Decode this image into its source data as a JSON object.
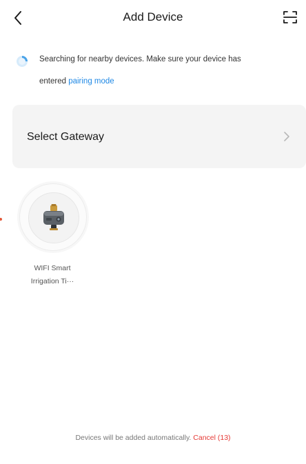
{
  "header": {
    "back_icon": "chevron-left-icon",
    "title": "Add Device",
    "scan_icon": "scan-frame-icon"
  },
  "search": {
    "spinner_icon": "loading-spinner-icon",
    "message_line1": "Searching for nearby devices. Make sure your device has",
    "message_line2_prefix": "entered ",
    "pairing_link": "pairing mode"
  },
  "gateway": {
    "label": "Select Gateway",
    "chevron_icon": "chevron-right-icon"
  },
  "devices": [
    {
      "name_line1": "WIFI Smart",
      "name_line2": "Irrigation Ti···",
      "icon": "irrigation-timer-icon"
    }
  ],
  "footer": {
    "message": "Devices will be added automatically. ",
    "cancel_label": "Cancel (13)"
  },
  "colors": {
    "accent_link": "#1e88e5",
    "cancel": "#e53935",
    "card_bg": "#f4f4f4"
  }
}
